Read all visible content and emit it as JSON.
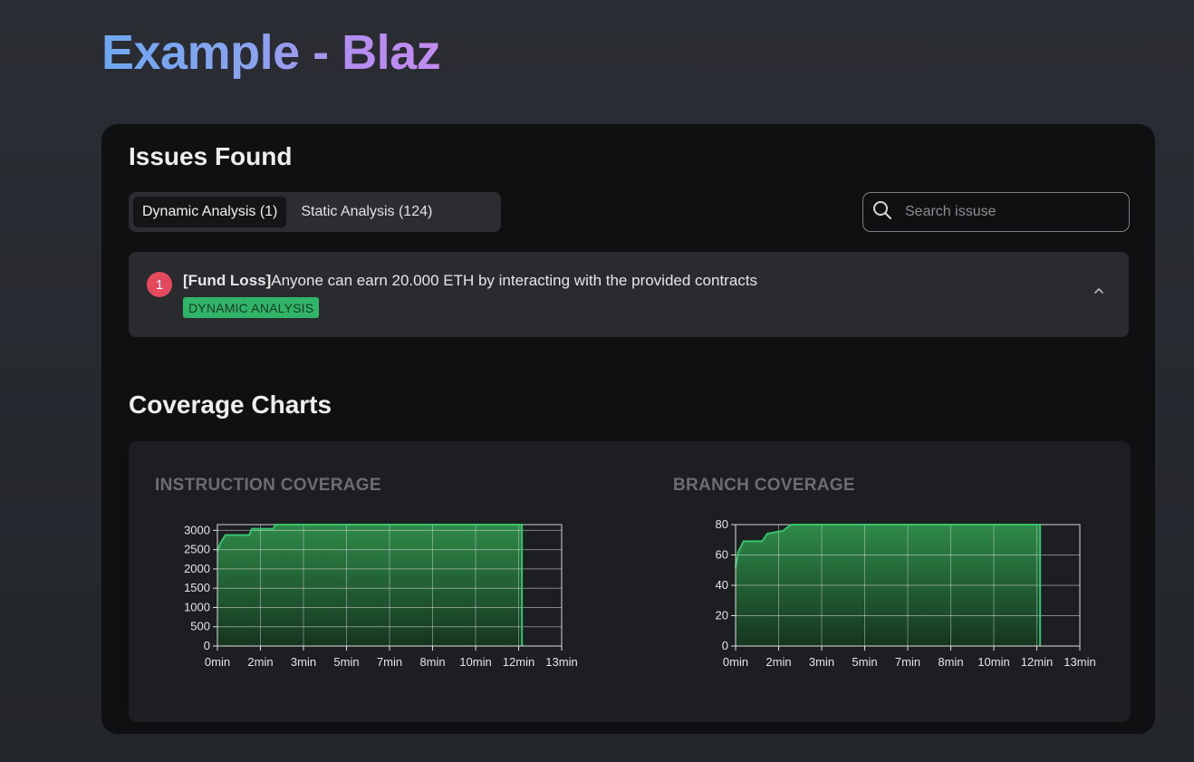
{
  "page": {
    "title": "Example - Blaz"
  },
  "issues": {
    "heading": "Issues Found",
    "tabs": [
      {
        "label": "Dynamic Analysis (1)",
        "active": true
      },
      {
        "label": "Static Analysis (124)",
        "active": false
      }
    ],
    "search": {
      "placeholder": "Search issuse",
      "icon": "search-icon"
    },
    "items": [
      {
        "number": "1",
        "tag": "[Fund Loss]",
        "text": "Anyone can earn 20.000 ETH by interacting with the provided contracts",
        "badge": "DYNAMIC ANALYSIS",
        "expand_icon": "chevron-up-icon"
      }
    ]
  },
  "coverage": {
    "heading": "Coverage Charts"
  },
  "colors": {
    "accent_green": "#2fb468",
    "danger_red": "#e5495e",
    "panel_bg": "#0f1012"
  },
  "chart_data": [
    {
      "type": "area",
      "title": "INSTRUCTION COVERAGE",
      "x_ticks": [
        "0min",
        "2min",
        "3min",
        "5min",
        "7min",
        "8min",
        "10min",
        "12min",
        "13min"
      ],
      "y_ticks": [
        0,
        500,
        1000,
        1500,
        2000,
        2500,
        3000
      ],
      "ylim": [
        0,
        3150
      ],
      "xlim": [
        0,
        13
      ],
      "grid": true,
      "series": [
        {
          "values": [
            {
              "x": 0,
              "y": 2450
            },
            {
              "x": 0.1,
              "y": 2650
            },
            {
              "x": 0.3,
              "y": 2880
            },
            {
              "x": 1.2,
              "y": 2880
            },
            {
              "x": 1.3,
              "y": 3040
            },
            {
              "x": 2.1,
              "y": 3040
            },
            {
              "x": 2.2,
              "y": 3150
            },
            {
              "x": 11.5,
              "y": 3150
            }
          ]
        }
      ]
    },
    {
      "type": "area",
      "title": "BRANCH COVERAGE",
      "x_ticks": [
        "0min",
        "2min",
        "3min",
        "5min",
        "7min",
        "8min",
        "10min",
        "12min",
        "13min"
      ],
      "y_ticks": [
        0,
        20,
        40,
        60,
        80
      ],
      "ylim": [
        0,
        80
      ],
      "xlim": [
        0,
        13
      ],
      "grid": true,
      "series": [
        {
          "values": [
            {
              "x": 0,
              "y": 52
            },
            {
              "x": 0.1,
              "y": 62
            },
            {
              "x": 0.3,
              "y": 69
            },
            {
              "x": 1.0,
              "y": 69
            },
            {
              "x": 1.2,
              "y": 74
            },
            {
              "x": 1.8,
              "y": 76
            },
            {
              "x": 2.1,
              "y": 80
            },
            {
              "x": 11.5,
              "y": 80
            }
          ]
        }
      ]
    }
  ]
}
